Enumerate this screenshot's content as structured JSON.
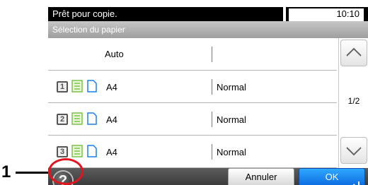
{
  "status": {
    "message": "Prêt pour copie.",
    "time": "10:10"
  },
  "header": {
    "title": "Sélection du papier"
  },
  "list": {
    "auto_label": "Auto",
    "rows": [
      {
        "tray": "1",
        "size": "A4",
        "type": "Normal"
      },
      {
        "tray": "2",
        "size": "A4",
        "type": "Normal"
      },
      {
        "tray": "3",
        "size": "A4",
        "type": "Normal"
      }
    ]
  },
  "pager": {
    "indicator": "1/2"
  },
  "footer": {
    "cancel_label": "Annuler",
    "ok_label": "OK",
    "help_glyph": "?"
  },
  "callout": {
    "number": "1"
  },
  "icons": [
    "paper-stack-icon",
    "portrait-orientation-icon",
    "chevron-up-icon",
    "chevron-down-icon",
    "help-icon",
    "enter-icon"
  ],
  "colors": {
    "status_bg": "#000000",
    "ok_blue": "#1a7fe8",
    "callout_red": "#e3141e",
    "paper_green": "#7cc34a"
  }
}
